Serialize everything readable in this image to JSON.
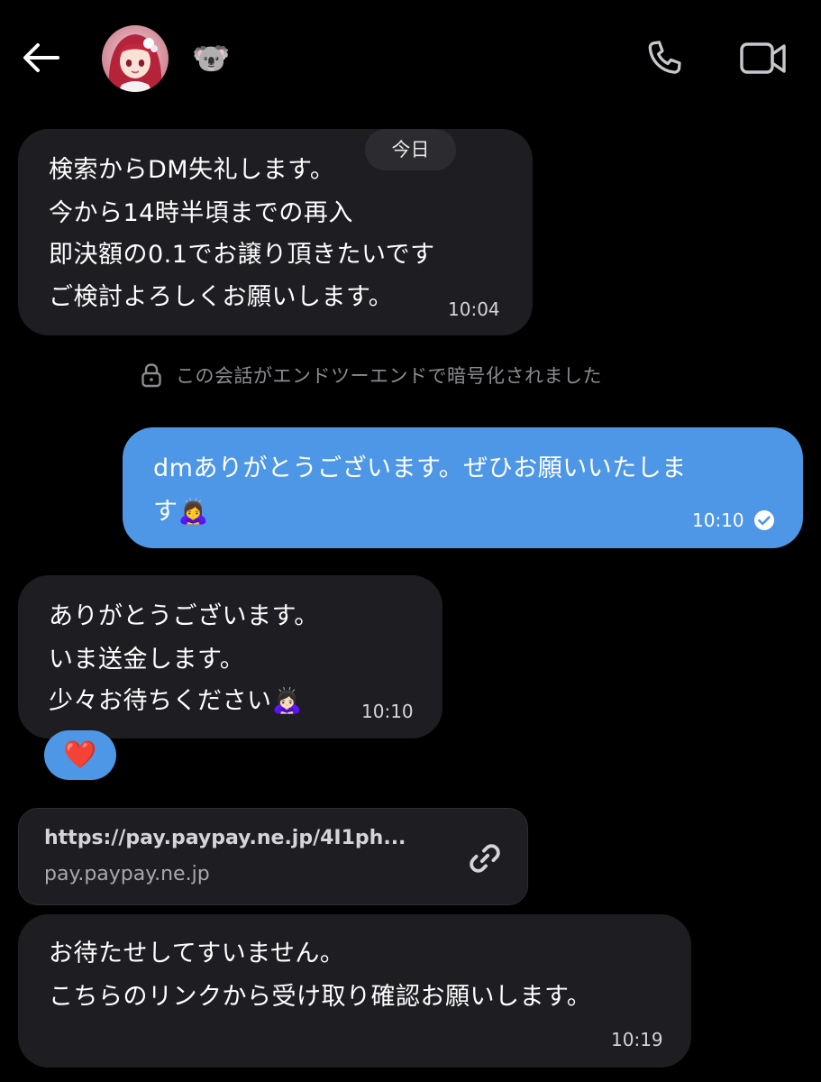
{
  "header": {
    "back_icon": "arrow-left-icon",
    "contact_emoji": "🐨",
    "call_icon": "phone-icon",
    "video_icon": "video-camera-icon"
  },
  "date_separator": "今日",
  "messages": [
    {
      "direction": "incoming",
      "lines": [
        "検索からDM失礼します。",
        "今から14時半頃までの再入",
        "即決額の0.1でお譲り頂きたいです",
        "ご検討よろしくお願いします。"
      ],
      "time": "10:04"
    },
    {
      "direction": "outgoing",
      "lines": [
        "dmありがとうございます。ぜひお願いいたしま",
        "す🙇‍♀️"
      ],
      "time": "10:10",
      "status_icon": "read-check-icon"
    },
    {
      "direction": "incoming",
      "lines": [
        "ありがとうございます。",
        "いま送金します。",
        "少々お待ちください🙇🏻‍♀️"
      ],
      "time": "10:10",
      "reaction": "❤️"
    },
    {
      "direction": "incoming",
      "lines": [
        "お待たせしてすいません。",
        "こちらのリンクから受け取り確認お願いします。"
      ],
      "time": "10:19"
    }
  ],
  "e2e_notice": "この会話がエンドツーエンドで暗号化されました",
  "link_preview": {
    "url": "https://pay.paypay.ne.jp/4I1ph...",
    "domain": "pay.paypay.ne.jp",
    "icon": "link-icon"
  },
  "colors": {
    "background": "#000000",
    "incoming_bubble": "#1d1d22",
    "outgoing_bubble": "#4e97e6",
    "muted_text": "#8b8b90"
  }
}
